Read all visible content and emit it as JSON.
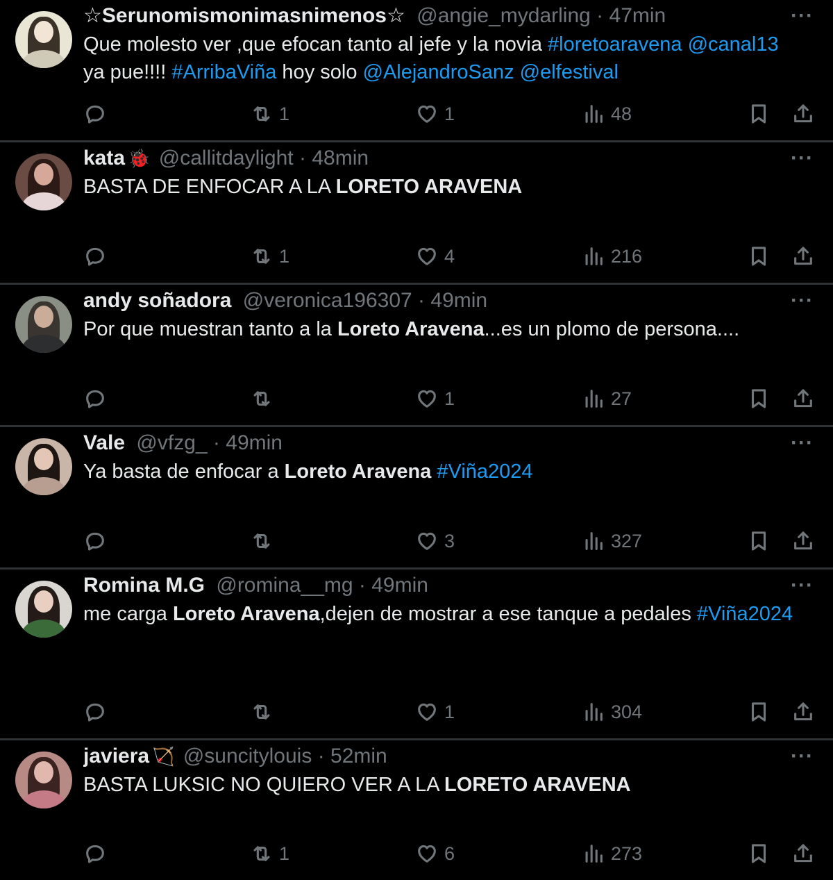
{
  "tweets": [
    {
      "name": "☆Serunomismonimasnimenos☆",
      "emoji": "",
      "handle": "@angie_mydarling",
      "sep": "·",
      "time": "47min",
      "text": [
        {
          "t": "Que molesto ver ,que efocan tanto al jefe y la novia ",
          "s": "n"
        },
        {
          "t": "#loretoaravena",
          "s": "l"
        },
        {
          "t": " ",
          "s": "n"
        },
        {
          "t": "@canal13",
          "s": "l"
        },
        {
          "t": " ya pue!!!! ",
          "s": "n"
        },
        {
          "t": "#ArribaViña",
          "s": "l"
        },
        {
          "t": " hoy solo ",
          "s": "n"
        },
        {
          "t": "@AlejandroSanz",
          "s": "l"
        },
        {
          "t": " ",
          "s": "n"
        },
        {
          "t": "@elfestival",
          "s": "l"
        }
      ],
      "replies": "",
      "retweets": "1",
      "likes": "1",
      "views": "48",
      "avatar_colors": {
        "bg": "#e9e6d5",
        "hair": "#3a3128",
        "skin": "#f3e5d6",
        "body": "#cfc9b8"
      }
    },
    {
      "name": "kata",
      "emoji": "🐞",
      "handle": "@callitdaylight",
      "sep": "·",
      "time": "48min",
      "text": [
        {
          "t": "BASTA DE ENFOCAR A LA ",
          "s": "n"
        },
        {
          "t": "LORETO ARAVENA",
          "s": "b"
        }
      ],
      "replies": "",
      "retweets": "1",
      "likes": "4",
      "views": "216",
      "avatar_colors": {
        "bg": "#6b4c45",
        "hair": "#2b1a15",
        "skin": "#d6a89a",
        "body": "#e6d6d8"
      }
    },
    {
      "name": "andy soñadora",
      "emoji": "",
      "handle": "@veronica196307",
      "sep": "·",
      "time": "49min",
      "text": [
        {
          "t": "Por que muestran tanto a la ",
          "s": "n"
        },
        {
          "t": "Loreto Aravena",
          "s": "b"
        },
        {
          "t": "...es un plomo de persona....",
          "s": "n"
        }
      ],
      "replies": "",
      "retweets": "",
      "likes": "1",
      "views": "27",
      "avatar_colors": {
        "bg": "#8a8f86",
        "hair": "#3a3530",
        "skin": "#c9ad98",
        "body": "#2d2e30"
      }
    },
    {
      "name": "Vale",
      "emoji": "",
      "handle": "@vfzg_",
      "sep": "·",
      "time": "49min",
      "text": [
        {
          "t": "Ya basta de enfocar a ",
          "s": "n"
        },
        {
          "t": "Loreto Aravena",
          "s": "b"
        },
        {
          "t": " ",
          "s": "n"
        },
        {
          "t": "#Viña2024",
          "s": "l"
        }
      ],
      "replies": "",
      "retweets": "",
      "likes": "3",
      "views": "327",
      "avatar_colors": {
        "bg": "#c9b6a8",
        "hair": "#1d1612",
        "skin": "#e3c6b5",
        "body": "#b79e90"
      }
    },
    {
      "name": "Romina M.G",
      "emoji": "",
      "handle": "@romina__mg",
      "sep": "·",
      "time": "49min",
      "text": [
        {
          "t": "me carga ",
          "s": "n"
        },
        {
          "t": "Loreto Aravena",
          "s": "b"
        },
        {
          "t": ",dejen de mostrar a ese tanque a pedales ",
          "s": "n"
        },
        {
          "t": "#Viña2024",
          "s": "l"
        }
      ],
      "replies": "",
      "retweets": "",
      "likes": "1",
      "views": "304",
      "avatar_colors": {
        "bg": "#d9d6d1",
        "hair": "#241a17",
        "skin": "#e8cfc2",
        "body": "#3c6b3a"
      }
    },
    {
      "name": "javiera",
      "emoji": "🏹",
      "handle": "@suncitylouis",
      "sep": "·",
      "time": "52min",
      "text": [
        {
          "t": "BASTA LUKSIC NO QUIERO VER A LA ",
          "s": "n"
        },
        {
          "t": "LORETO ARAVENA",
          "s": "b"
        }
      ],
      "replies": "",
      "retweets": "1",
      "likes": "6",
      "views": "273",
      "avatar_colors": {
        "bg": "#b88a86",
        "hair": "#3a2321",
        "skin": "#e0b8ad",
        "body": "#c47b86"
      }
    }
  ],
  "more_label": "···",
  "colors": {
    "background": "#000000",
    "text": "#e7e9ea",
    "muted": "#71767b",
    "link": "#1d9bf0",
    "divider": "#2f3336"
  },
  "icons": [
    "reply-icon",
    "retweet-icon",
    "like-icon",
    "views-icon",
    "bookmark-icon",
    "share-icon",
    "more-icon"
  ]
}
